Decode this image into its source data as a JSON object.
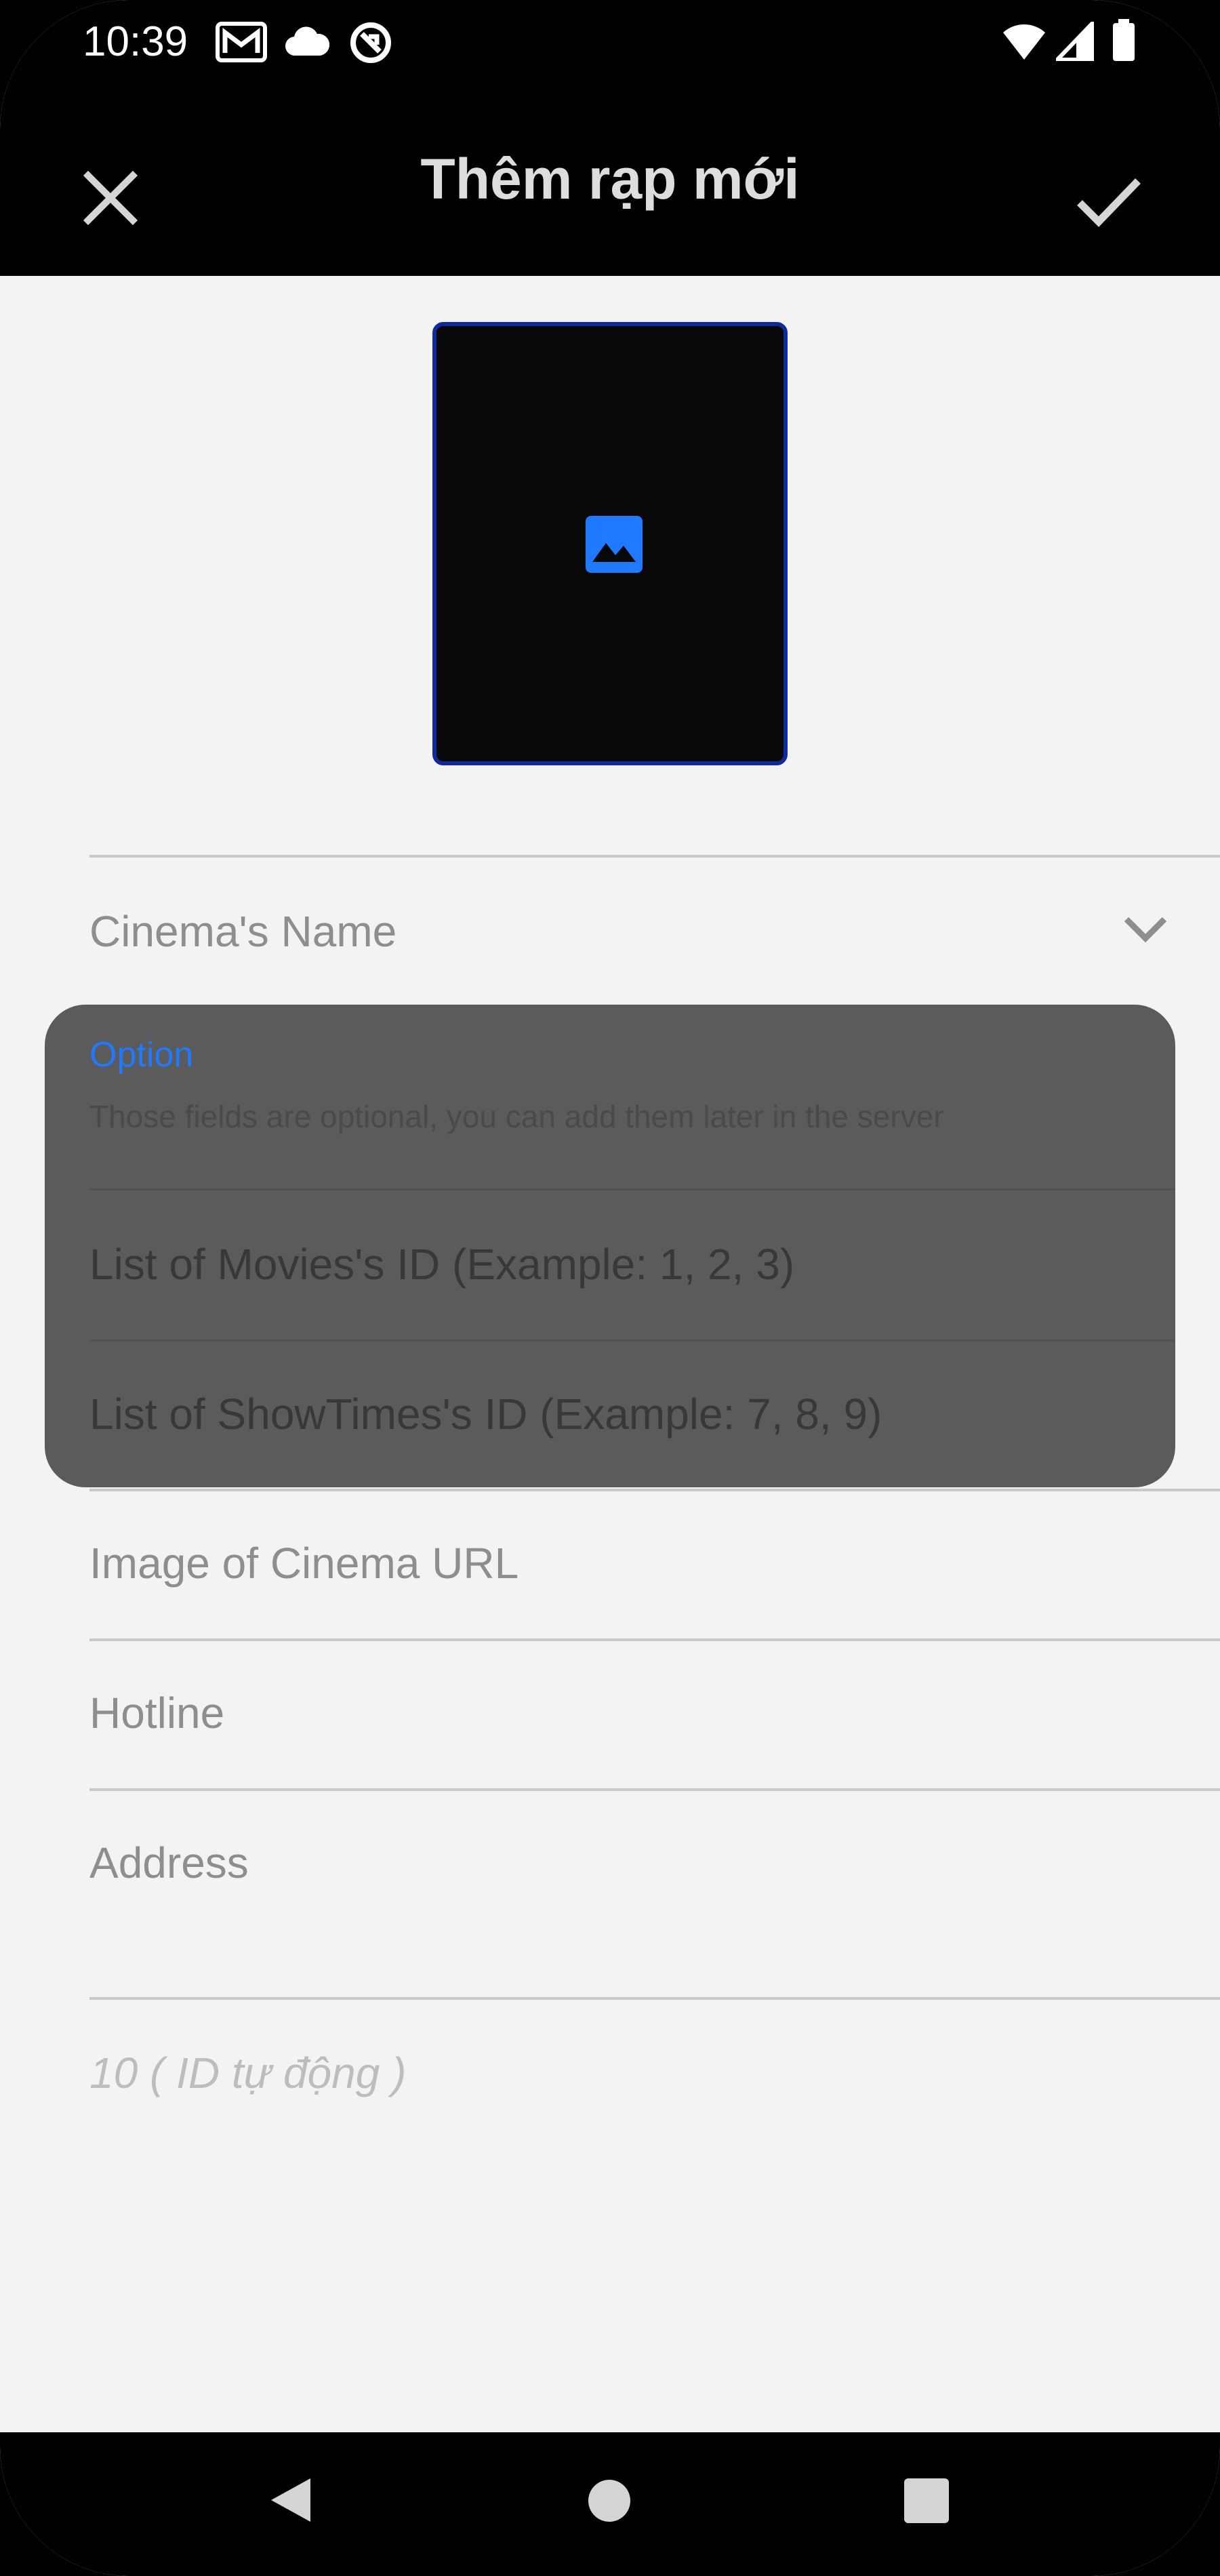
{
  "status_bar": {
    "time": "10:39",
    "icons": [
      "gmail-icon",
      "cloud-icon",
      "sync-icon",
      "wifi-icon",
      "signal-icon",
      "battery-icon"
    ]
  },
  "app_bar": {
    "title": "Thêm rạp mới",
    "close_icon": "close-icon",
    "confirm_icon": "check-icon"
  },
  "image_picker": {
    "icon": "image-icon",
    "accent_color": "#1f7aff"
  },
  "form": {
    "cinema_name_label": "Cinema's Name",
    "image_url_label": "Image of Cinema URL",
    "hotline_label": "Hotline",
    "address_label": "Address",
    "auto_id": "10 ( ID tự động )"
  },
  "option_card": {
    "title": "Option",
    "description": "Those fields are optional, you can add them later in the server",
    "movies_field": "List of Movies's ID (Example: 1, 2, 3)",
    "showtimes_field": "List of ShowTimes's ID (Example: 7, 8, 9)"
  },
  "nav_bar": {
    "buttons": [
      "back-icon",
      "home-icon",
      "recents-icon"
    ]
  }
}
